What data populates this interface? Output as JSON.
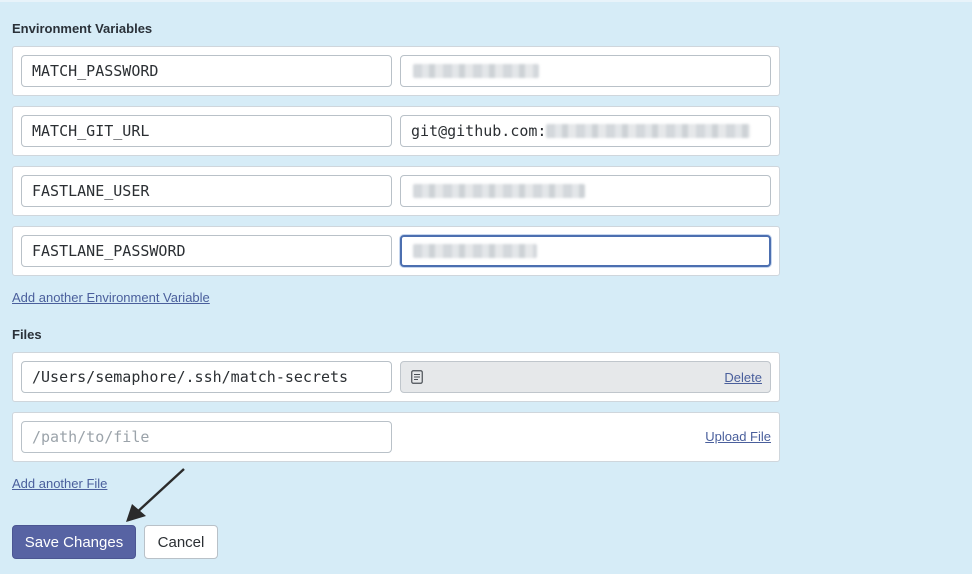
{
  "env_section": {
    "title": "Environment Variables",
    "rows": [
      {
        "name": "MATCH_PASSWORD",
        "value_prefix": "",
        "value_redacted": true
      },
      {
        "name": "MATCH_GIT_URL",
        "value_prefix": "git@github.com:",
        "value_redacted": true
      },
      {
        "name": "FASTLANE_USER",
        "value_prefix": "",
        "value_redacted": true
      },
      {
        "name": "FASTLANE_PASSWORD",
        "value_prefix": "",
        "value_redacted": true
      }
    ],
    "add_link": "Add another Environment Variable"
  },
  "files_section": {
    "title": "Files",
    "existing_file": {
      "path": "/Users/semaphore/.ssh/match-secrets",
      "icon": "file-icon",
      "delete_label": "Delete"
    },
    "new_file": {
      "placeholder": "/path/to/file",
      "upload_label": "Upload File"
    },
    "add_link": "Add another File"
  },
  "actions": {
    "save_label": "Save Changes",
    "cancel_label": "Cancel"
  },
  "annotation": {
    "icon": "arrow-icon"
  },
  "colors": {
    "background": "#d6ecf7",
    "primary_button": "#5763a3",
    "link": "#4a5f9c",
    "focus_border": "#4c6fb0"
  }
}
